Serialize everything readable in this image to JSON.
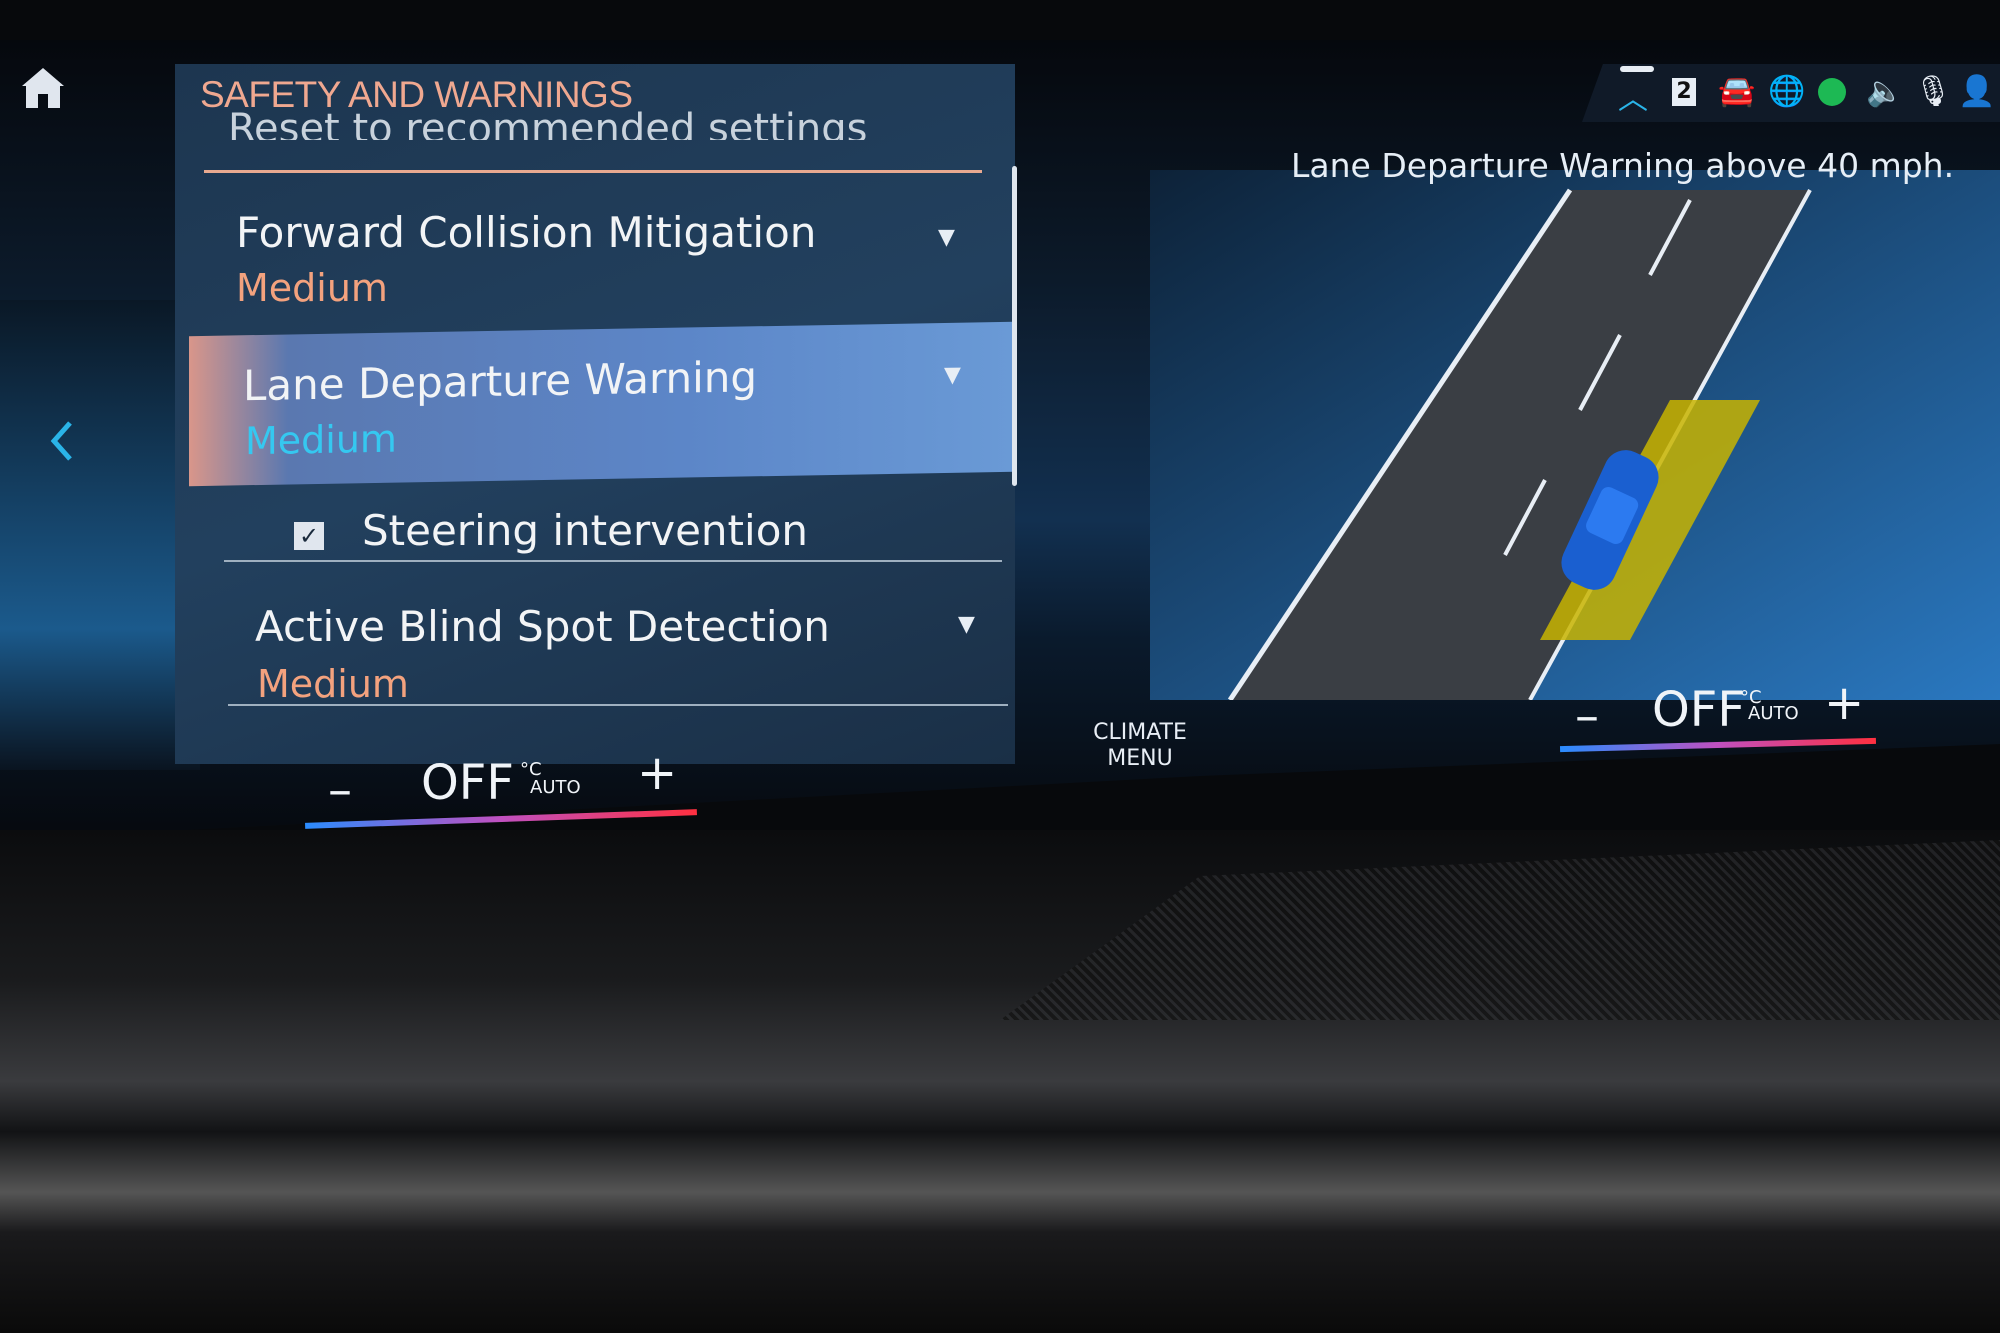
{
  "header": {
    "title": "SAFETY AND WARNINGS",
    "partial_item": "Reset to recommended settings"
  },
  "icons": {
    "home": "home-icon",
    "back": "chevron-left-icon"
  },
  "items": [
    {
      "label": "Forward Collision Mitigation",
      "value": "Medium"
    },
    {
      "label": "Lane Departure Warning",
      "value": "Medium",
      "selected": true
    },
    {
      "label": "Steering intervention",
      "checked": true
    },
    {
      "label": "Active Blind Spot Detection",
      "value": "Medium"
    }
  ],
  "status_bar": {
    "icons": [
      "chevron-up-icon",
      "display-number-icon",
      "connected-car-icon",
      "globe-shield-icon",
      "spotify-icon",
      "speaker-icon",
      "microphone-icon",
      "user-profile-icon"
    ],
    "display_number": "2"
  },
  "info": {
    "message": "Lane Departure Warning above 40 mph."
  },
  "climate": {
    "menu_label_1": "CLIMATE",
    "menu_label_2": "MENU",
    "left": {
      "minus": "–",
      "value": "OFF",
      "unit": "°C",
      "mode": "AUTO",
      "plus": "+"
    },
    "right": {
      "minus": "–",
      "value": "OFF",
      "unit": "°C",
      "mode": "AUTO",
      "plus": "+"
    }
  },
  "colors": {
    "accent": "#2ab4e8",
    "title": "#f0a890",
    "value": "#f3a27e",
    "selected_value": "#35c8f0",
    "spotify": "#1db954"
  }
}
